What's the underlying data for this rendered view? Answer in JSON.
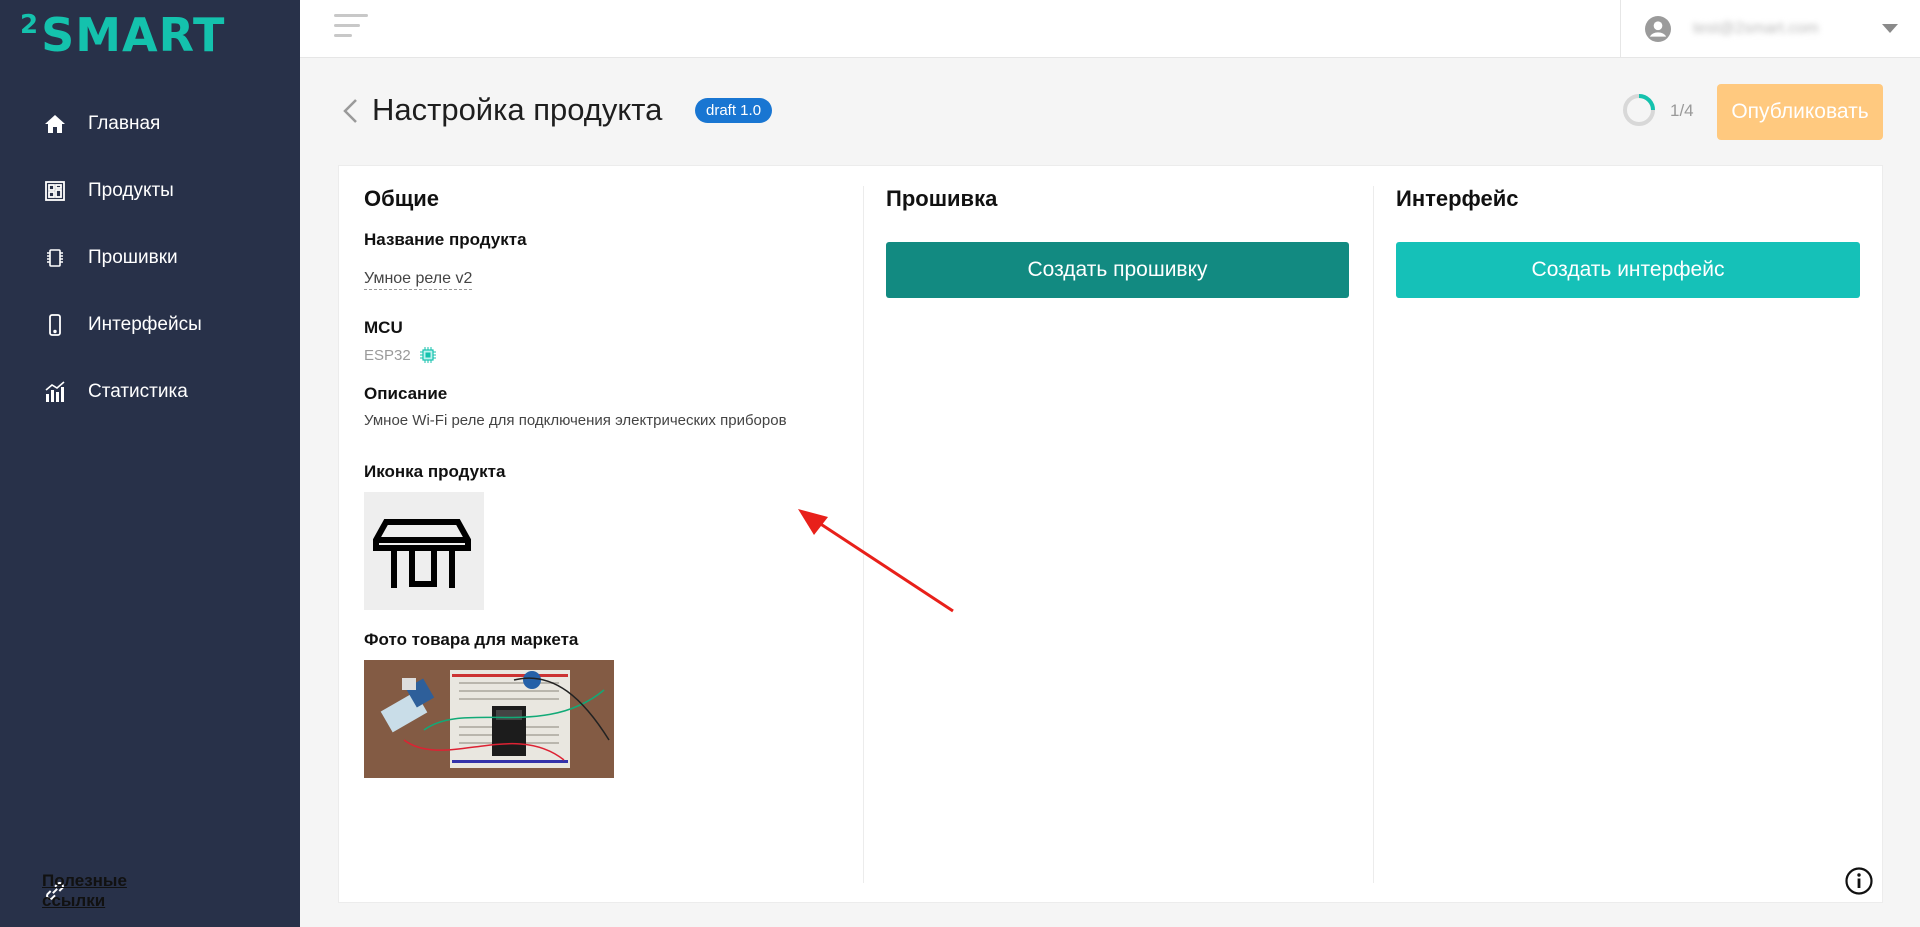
{
  "app": {
    "logo_text": "SMART",
    "logo_super": "2",
    "brand_color": "#14c2ad"
  },
  "sidebar": {
    "items": [
      {
        "label": "Главная",
        "icon": "home-icon"
      },
      {
        "label": "Продукты",
        "icon": "products-icon"
      },
      {
        "label": "Прошивки",
        "icon": "chip-icon"
      },
      {
        "label": "Интерфейсы",
        "icon": "phone-icon"
      },
      {
        "label": "Статистика",
        "icon": "stats-icon"
      }
    ],
    "useful_links": {
      "label": "Полезные ссылки",
      "icon": "link-icon"
    },
    "bg_color": "#283149"
  },
  "topbar": {
    "menu_icon": "hamburger-icon",
    "user_email": "test@2smart.com",
    "avatar_icon": "user-avatar-icon"
  },
  "header": {
    "title": "Настройка продукта",
    "badge": "draft 1.0",
    "progress_text": "1/4",
    "progress_value": 0.25,
    "publish_label": "Опубликовать"
  },
  "general": {
    "title": "Общие",
    "name_label": "Название продукта",
    "name_value": "Умное реле v2",
    "mcu_label": "MCU",
    "mcu_value": "ESP32",
    "description_label": "Описание",
    "description_value": "Умное Wi-Fi реле для подключения электрических приборов",
    "icon_label": "Иконка продукта",
    "photo_label": "Фото товара для маркета"
  },
  "firmware": {
    "title": "Прошивка",
    "create_label": "Создать прошивку",
    "button_color": "#128a81"
  },
  "interface": {
    "title": "Интерфейс",
    "create_label": "Создать интерфейс",
    "button_color": "#15c1b8"
  },
  "annotation": {
    "arrow_color": "#e8201a"
  }
}
